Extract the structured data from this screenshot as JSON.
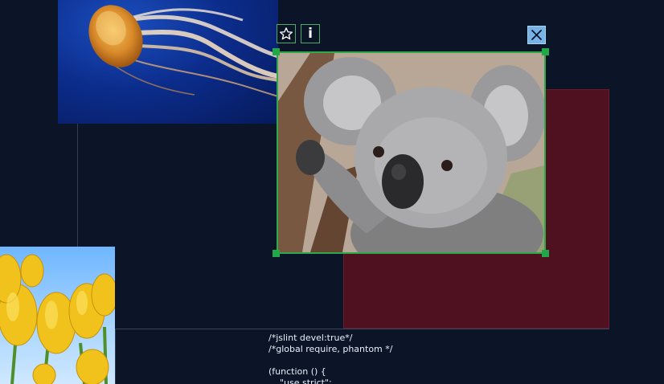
{
  "canvas": {
    "background_color": "#0c1528"
  },
  "photos": {
    "jellyfish": {
      "subject": "jellyfish"
    },
    "koala": {
      "subject": "koala",
      "selected": true
    },
    "tulips": {
      "subject": "tulips"
    }
  },
  "shapes": {
    "maroon_rect_color": "#4f1020"
  },
  "selection": {
    "border_color": "#2fa84a",
    "handle_color": "#22a84a",
    "star_icon": "star-icon",
    "info_icon": "info-icon",
    "info_label": "i",
    "close_icon": "close-icon",
    "close_color": "#79b3e6"
  },
  "code_panel": {
    "text": "/*jslint devel:true*/\n/*global require, phantom */\n\n(function () {\n    \"use strict\";"
  }
}
